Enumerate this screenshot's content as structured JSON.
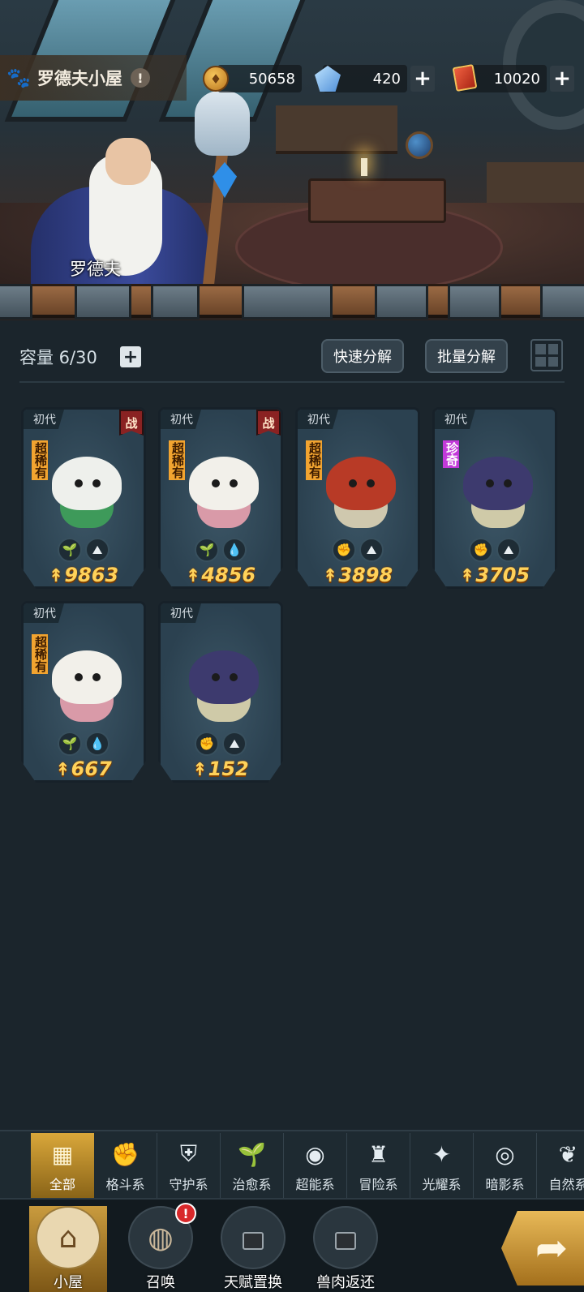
{
  "header": {
    "title": "罗德夫小屋",
    "info_symbol": "!",
    "paw_icon": "paw-icon",
    "resources": [
      {
        "icon": "gold-coin-icon",
        "value": "50658"
      },
      {
        "icon": "crystal-gem-icon",
        "value": "420"
      },
      {
        "icon": "summon-ticket-icon",
        "value": "10020"
      }
    ],
    "plus_symbol": "+"
  },
  "npc": {
    "name": "罗德夫"
  },
  "inventory": {
    "capacity_label": "容量 6/30",
    "plus_symbol": "+",
    "quick_decompose_label": "快速分解",
    "batch_decompose_label": "批量分解"
  },
  "cards": [
    {
      "generation": "初代",
      "battle": "战",
      "rarity": "超稀有",
      "rarity_class": "ssr",
      "monster": "white-owl-spirit",
      "elements": [
        "sprout-icon",
        "earth-icon"
      ],
      "power": "9863"
    },
    {
      "generation": "初代",
      "battle": "战",
      "rarity": "超稀有",
      "rarity_class": "ssr",
      "monster": "pink-larva",
      "elements": [
        "sprout-icon",
        "water-drop-icon"
      ],
      "power": "4856"
    },
    {
      "generation": "初代",
      "battle": "",
      "rarity": "超稀有",
      "rarity_class": "ssr",
      "monster": "red-mushroom",
      "elements": [
        "fist-icon",
        "earth-icon"
      ],
      "power": "3898"
    },
    {
      "generation": "初代",
      "battle": "",
      "rarity": "珍奇",
      "rarity_class": "rare",
      "monster": "purple-mushroom",
      "elements": [
        "fist-icon",
        "earth-icon"
      ],
      "power": "3705"
    },
    {
      "generation": "初代",
      "battle": "",
      "rarity": "超稀有",
      "rarity_class": "ssr",
      "monster": "pink-larva",
      "elements": [
        "sprout-icon",
        "water-drop-icon"
      ],
      "power": "667"
    },
    {
      "generation": "初代",
      "battle": "",
      "rarity": "",
      "rarity_class": "",
      "monster": "purple-mushroom",
      "elements": [
        "fist-icon",
        "earth-icon"
      ],
      "power": "152"
    }
  ],
  "filters": [
    {
      "label": "全部",
      "icon": "all-blocks-icon",
      "active": true
    },
    {
      "label": "格斗系",
      "icon": "fist-icon"
    },
    {
      "label": "守护系",
      "icon": "shield-icon"
    },
    {
      "label": "治愈系",
      "icon": "sprout-icon"
    },
    {
      "label": "超能系",
      "icon": "alien-head-icon"
    },
    {
      "label": "冒险系",
      "icon": "lantern-icon"
    },
    {
      "label": "光耀系",
      "icon": "star-burst-icon"
    },
    {
      "label": "暗影系",
      "icon": "eye-icon"
    },
    {
      "label": "自然系",
      "icon": "leaf-icon"
    }
  ],
  "bottom_nav": [
    {
      "label": "小屋",
      "icon": "house-icon",
      "active": true
    },
    {
      "label": "召唤",
      "icon": "egg-icon",
      "badge": "!"
    },
    {
      "label": "天赋置换",
      "icon": "talent-swap-icon",
      "locked": true
    },
    {
      "label": "兽肉返还",
      "icon": "meat-return-icon",
      "locked": true
    }
  ],
  "go_button": {
    "icon": "arrow-return-icon"
  },
  "colors": {
    "gold": "#ffd25a",
    "ssr": "#f2a430",
    "rare": "#c23ad9",
    "battle": "#8a2222",
    "active_tab": "#d9a73a"
  }
}
